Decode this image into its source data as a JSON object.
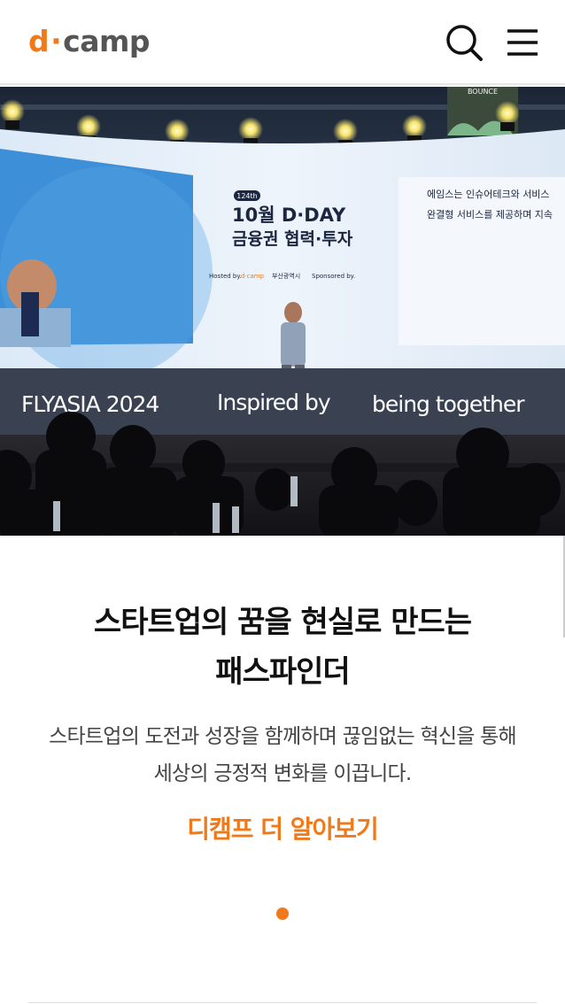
{
  "header": {
    "logo_d": "d",
    "logo_dot": "·",
    "logo_rest": "camp",
    "search_icon": "search-icon",
    "menu_icon": "hamburger-menu-icon"
  },
  "hero": {
    "screen_badge": "124th",
    "screen_title": "10월 D·DAY",
    "screen_subtitle": "금융권 협력·투자",
    "screen_hosted": "Hosted by.",
    "screen_hosted_logo": "d·camp",
    "screen_hosted_partner": "부산광역시",
    "screen_sponsored": "Sponsored by.",
    "screen_side_line1": "에임스는 인슈어테크와 서비스",
    "screen_side_line2": "완결형 서비스를 제공하며 지속",
    "banner_left": "FLYASIA 2024",
    "banner_mid": "Inspired by",
    "banner_right": "being together",
    "booth_sign": "BOUNCE"
  },
  "main": {
    "headline_line1": "스타트업의 꿈을 현실로 만드는",
    "headline_line2": "패스파인더",
    "desc_line1": "스타트업의 도전과 성장을 함께하며 끊임없는 혁신을 통해",
    "desc_line2": "세상의 긍정적 변화를 이끕니다.",
    "cta_label": "디캠프 더 알아보기"
  },
  "colors": {
    "accent": "#f07a1a",
    "text": "#111111",
    "muted": "#444444"
  }
}
